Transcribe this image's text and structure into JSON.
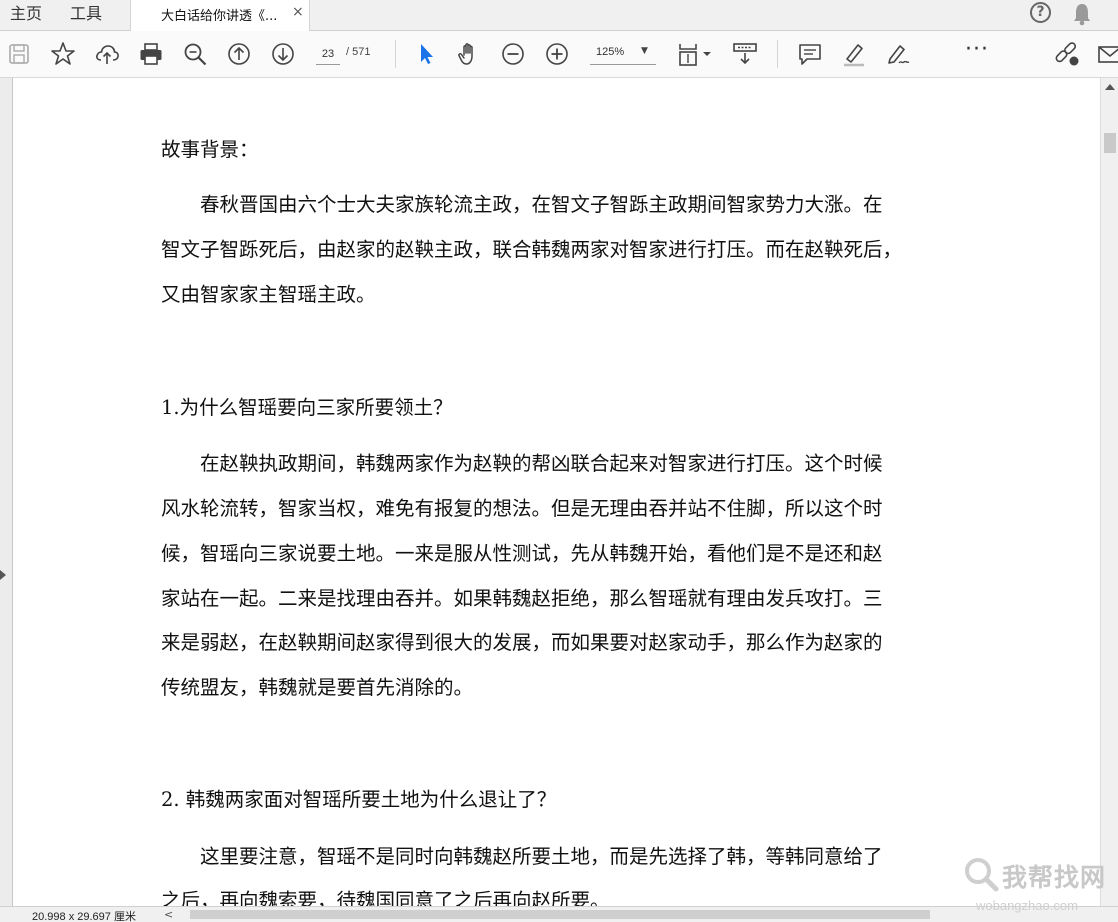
{
  "tabs": {
    "home_label": "主页",
    "tools_label": "工具",
    "document_tab_title": "大白话给你讲透《...",
    "close_glyph": "×"
  },
  "toolbar": {
    "current_page": "23",
    "total_pages": "/ 571",
    "zoom_level": "125%",
    "more_glyph": "···"
  },
  "icons": [
    "save-icon",
    "bookmark-star-icon",
    "upload-cloud-icon",
    "print-icon",
    "zoom-search-icon",
    "page-up-icon",
    "page-down-icon",
    "select-pointer-icon",
    "hand-icon",
    "zoom-out-icon",
    "zoom-in-icon",
    "fit-page-icon",
    "scroll-mode-icon",
    "comment-icon",
    "highlight-icon",
    "sign-icon",
    "share-link-icon",
    "email-icon",
    "help-icon",
    "bell-icon"
  ],
  "colors": {
    "select_tool_accent": "#1a73e8",
    "icon_default": "#444444"
  },
  "document": {
    "lines": [
      "故事背景：",
      "春秋晋国由六个士大夫家族轮流主政，在智文子智跞主政期间智家势力大涨。在",
      "智文子智跞死后，由赵家的赵鞅主政，联合韩魏两家对智家进行打压。而在赵鞅死后，",
      "又由智家家主智瑶主政。",
      "1.为什么智瑶要向三家所要领土？",
      "在赵鞅执政期间，韩魏两家作为赵鞅的帮凶联合起来对智家进行打压。这个时候",
      "风水轮流转，智家当权，难免有报复的想法。但是无理由吞并站不住脚，所以这个时",
      "候，智瑶向三家说要土地。一来是服从性测试，先从韩魏开始，看他们是不是还和赵",
      "家站在一起。二来是找理由吞并。如果韩魏赵拒绝，那么智瑶就有理由发兵攻打。三",
      "来是弱赵，在赵鞅期间赵家得到很大的发展，而如果要对赵家动手，那么作为赵家的",
      "传统盟友，韩魏就是要首先消除的。",
      "2.  韩魏两家面对智瑶所要土地为什么退让了？",
      "这里要注意，智瑶不是同时向韩魏赵所要土地，而是先选择了韩，等韩同意给了",
      "之后，再向魏索要，待魏国同意了之后再向赵所要。"
    ]
  },
  "status": {
    "page_size": "20.998 x 29.697 厘米",
    "scroll_left_glyph": "<"
  },
  "watermark": {
    "brand": "我帮找网",
    "url": "wobangzhao.com"
  }
}
